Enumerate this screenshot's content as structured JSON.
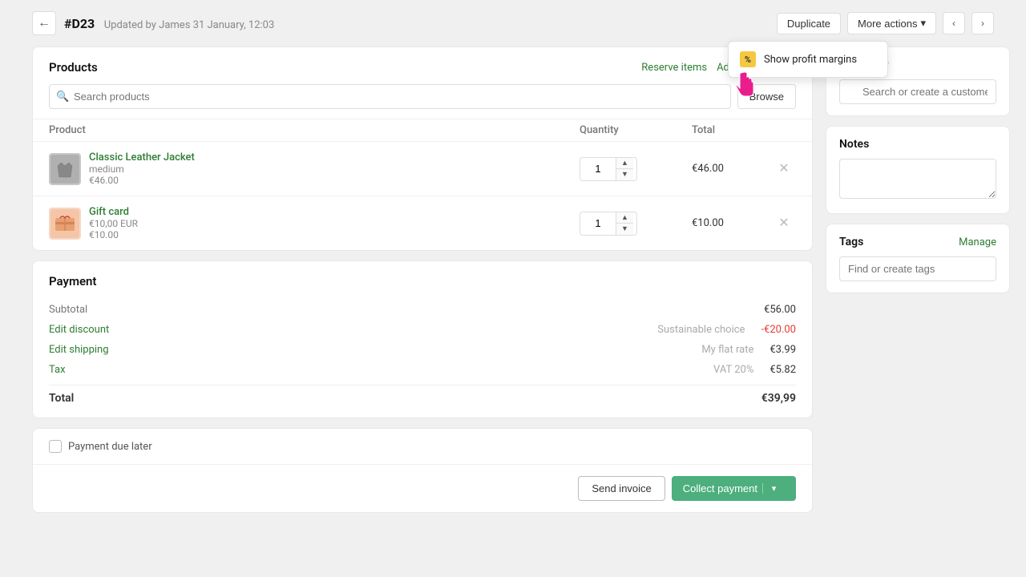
{
  "header": {
    "back_label": "←",
    "order_id": "#D23",
    "order_meta": "Updated by James 31 January, 12:03",
    "duplicate_label": "Duplicate",
    "more_actions_label": "More actions",
    "nav_prev": "‹",
    "nav_next": "›"
  },
  "dropdown": {
    "show_profit_label": "Show profit margins",
    "icon_label": "%"
  },
  "products_section": {
    "title": "Products",
    "reserve_items_label": "Reserve items",
    "add_custom_label": "Add custom item",
    "search_placeholder": "Search products",
    "browse_label": "Browse",
    "col_product": "Product",
    "col_quantity": "Quantity",
    "col_total": "Total",
    "items": [
      {
        "name": "Classic Leather Jacket",
        "variant": "medium",
        "price": "€46.00",
        "qty": "1",
        "total": "€46.00",
        "img_type": "jacket"
      },
      {
        "name": "Gift card",
        "variant": "€10,00 EUR",
        "price": "€10.00",
        "qty": "1",
        "total": "€10.00",
        "img_type": "giftcard"
      }
    ]
  },
  "payment_section": {
    "title": "Payment",
    "rows": [
      {
        "label": "Subtotal",
        "desc": "",
        "value": "€56.00",
        "type": "normal",
        "label_type": "plain"
      },
      {
        "label": "Edit discount",
        "desc": "Sustainable choice",
        "value": "-€20.00",
        "type": "negative",
        "label_type": "link"
      },
      {
        "label": "Edit shipping",
        "desc": "My flat rate",
        "value": "€3.99",
        "type": "normal",
        "label_type": "link"
      },
      {
        "label": "Tax",
        "desc": "VAT 20%",
        "value": "€5.82",
        "type": "normal",
        "label_type": "link"
      }
    ],
    "total_label": "Total",
    "total_value": "€39,99",
    "payment_due_label": "Payment due later"
  },
  "footer": {
    "send_invoice_label": "Send invoice",
    "collect_payment_label": "Collect payment",
    "collect_dropdown_arrow": "▾"
  },
  "customer_section": {
    "title": "Customer",
    "search_placeholder": "Search or create a customer"
  },
  "notes_section": {
    "title": "Notes"
  },
  "tags_section": {
    "title": "Tags",
    "manage_label": "Manage",
    "placeholder": "Find or create tags"
  }
}
